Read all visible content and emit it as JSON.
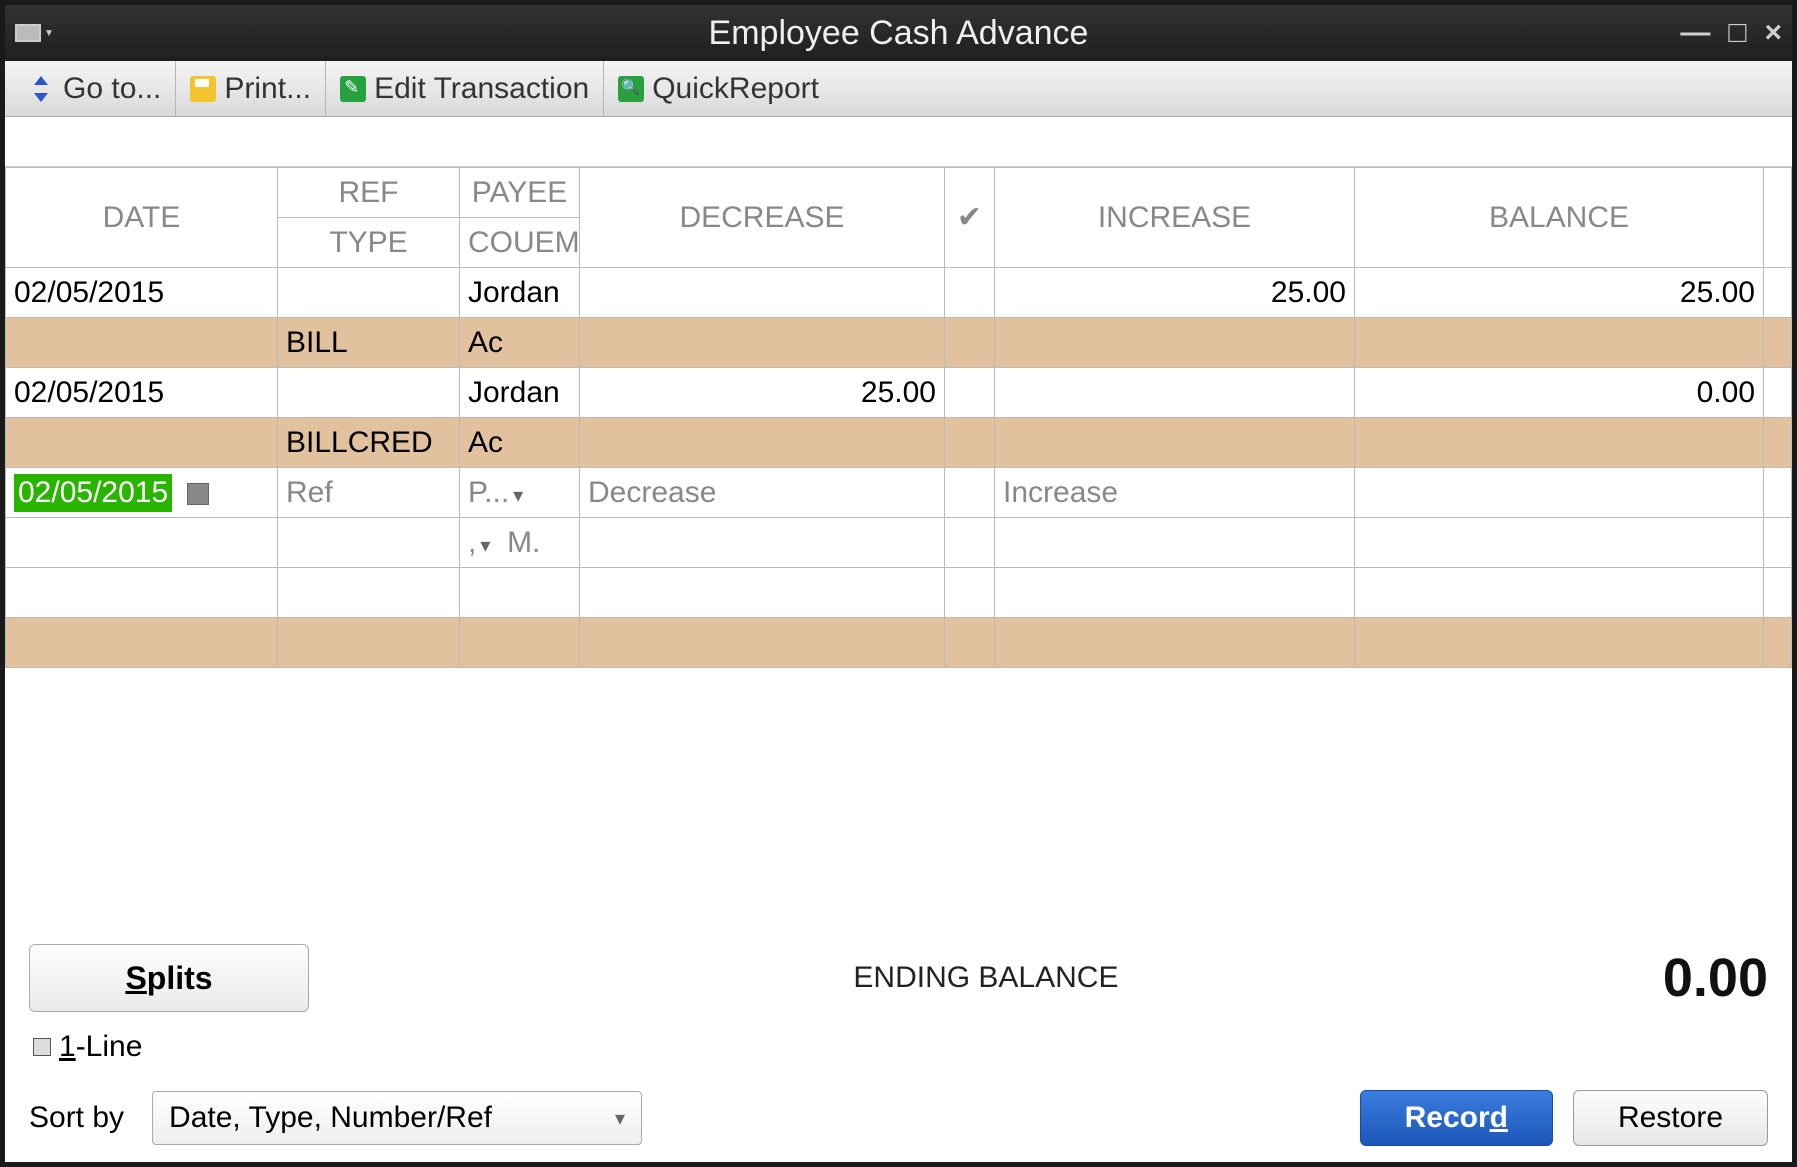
{
  "window": {
    "title": "Employee Cash Advance"
  },
  "toolbar": {
    "goto": "Go to...",
    "print": "Print...",
    "edit": "Edit Transaction",
    "report": "QuickReport"
  },
  "headers": {
    "row1": {
      "date": "DATE",
      "ref": "REF",
      "payee": "PAYEE",
      "decrease": "DECREASE",
      "check": "✔",
      "increase": "INCREASE",
      "balance": "BALANCE"
    },
    "row2": {
      "type": "TYPE",
      "col": "COU",
      "mem": "EMO"
    }
  },
  "rows": [
    {
      "date": "02/05/2015",
      "ref": "",
      "payee": "Jordan",
      "decrease": "",
      "check": "",
      "increase": "25.00",
      "balance": "25.00",
      "type": "BILL",
      "account": "Ac"
    },
    {
      "date": "02/05/2015",
      "ref": "",
      "payee": "Jordan",
      "decrease": "25.00",
      "check": "",
      "increase": "",
      "balance": "0.00",
      "type": "BILLCRED",
      "account": "Ac"
    }
  ],
  "entry": {
    "date": "02/05/2015",
    "ref_ph": "Ref",
    "payee_ph": "P...",
    "decrease_ph": "Decrease",
    "increase_ph": "Increase",
    "account_ph": ",",
    "memo_ph": "M."
  },
  "footer": {
    "splits": "plits",
    "splits_u": "S",
    "ending_label": "ENDING BALANCE",
    "ending_value": "0.00",
    "oneline_u": "1",
    "oneline": "-Line",
    "sort_label": "Sort by",
    "sort_value": "Date, Type, Number/Ref",
    "record_pre": "Recor",
    "record_u": "d",
    "restore": "Restore"
  }
}
